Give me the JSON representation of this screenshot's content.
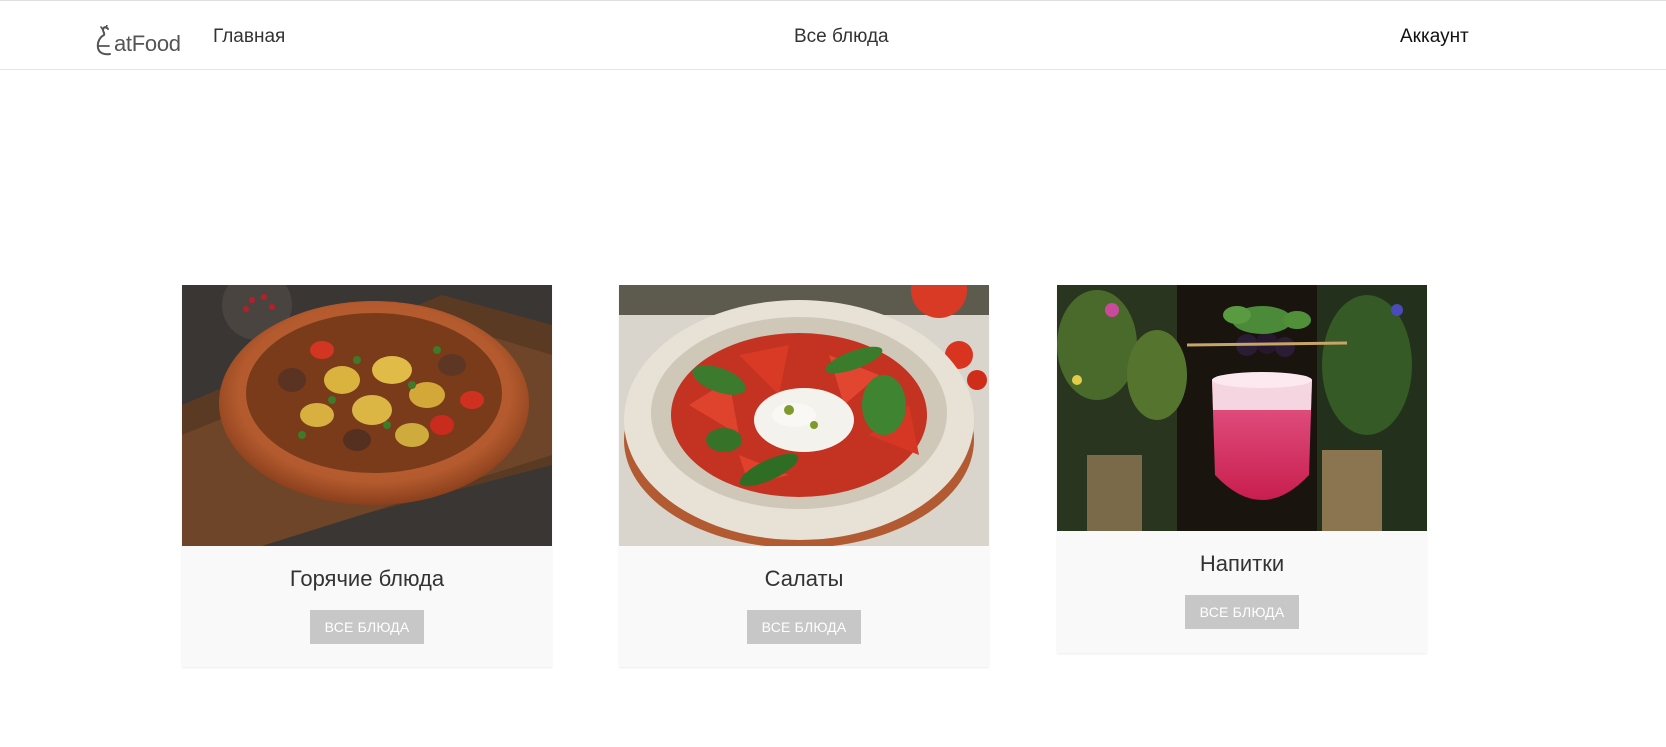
{
  "nav": {
    "logo_text": "atFood",
    "home_label": "Главная",
    "all_dishes_label": "Все блюда",
    "account_label": "Аккаунт"
  },
  "cards": [
    {
      "title": "Горячие блюда",
      "button_label": "ВСЕ БЛЮДА",
      "image": "hot-dishes-photo"
    },
    {
      "title": "Салаты",
      "button_label": "ВСЕ БЛЮДА",
      "image": "salad-photo"
    },
    {
      "title": "Напитки",
      "button_label": "ВСЕ БЛЮДА",
      "image": "drink-photo"
    }
  ],
  "colors": {
    "button_bg": "#c7c7c7",
    "card_bg": "#f9f9f9",
    "text": "#333333"
  }
}
